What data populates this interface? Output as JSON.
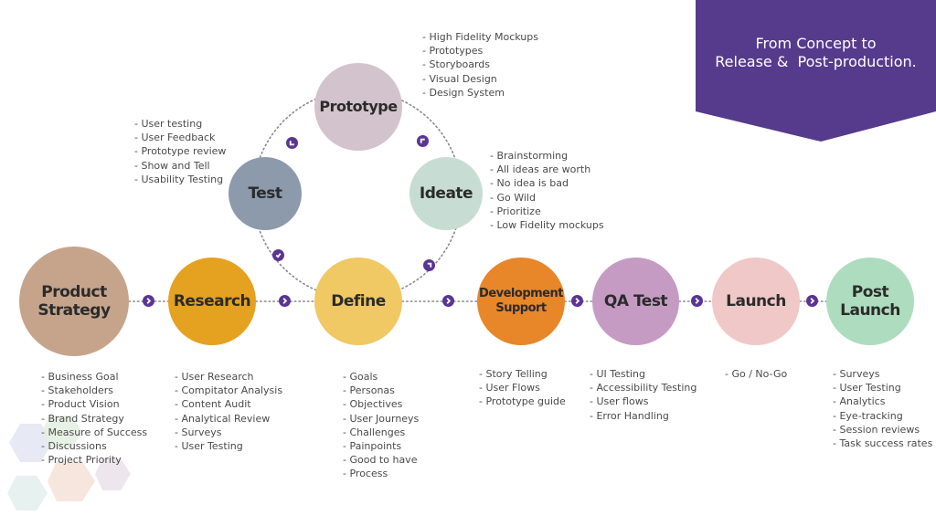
{
  "banner": {
    "line1": "From Concept to",
    "line2": "Release &  Post-production.",
    "color": "#563a8c"
  },
  "accent_color": "#5a3593",
  "main_flow": [
    {
      "id": "product-strategy",
      "label": "Product\nStrategy",
      "color": "#c6a48c",
      "items": [
        "Business Goal",
        "Stakeholders",
        "Product Vision",
        "Brand Strategy",
        "Measure of Success",
        "Discussions",
        "Project Priority"
      ]
    },
    {
      "id": "research",
      "label": "Research",
      "color": "#e5a120",
      "items": [
        "User Research",
        "Compitator Analysis",
        "Content Audit",
        "Analytical Review",
        "Surveys",
        "User Testing"
      ]
    },
    {
      "id": "define",
      "label": "Define",
      "color": "#f0c864",
      "items": [
        "Goals",
        "Personas",
        "Objectives",
        "User Journeys",
        "Challenges",
        "Painpoints",
        "Good to have",
        "Process"
      ]
    },
    {
      "id": "development-support",
      "label": "Development\nSupport",
      "color": "#e8862a",
      "items": [
        "Story Telling",
        "User Flows",
        "Prototype guide"
      ]
    },
    {
      "id": "qa-test",
      "label": "QA Test",
      "color": "#c59bc3",
      "items": [
        "UI Testing",
        "Accessibility Testing",
        "User flows",
        "Error Handling"
      ]
    },
    {
      "id": "launch",
      "label": "Launch",
      "color": "#f0c8c8",
      "items": [
        "Go / No-Go"
      ]
    },
    {
      "id": "post-launch",
      "label": "Post\nLaunch",
      "color": "#aedcbe",
      "items": [
        "Surveys",
        "User Testing",
        "Analytics",
        "Eye-tracking",
        "Session reviews",
        "Task success rates"
      ]
    }
  ],
  "cycle": [
    {
      "id": "test",
      "label": "Test",
      "color": "#8c9aab",
      "items": [
        "User testing",
        "User Feedback",
        "Prototype review",
        "Show and Tell",
        "Usability Testing"
      ]
    },
    {
      "id": "prototype",
      "label": "Prototype",
      "color": "#d3c3cc",
      "items": [
        "High Fidelity Mockups",
        "Prototypes",
        "Storyboards",
        "Visual Design",
        "Design System"
      ]
    },
    {
      "id": "ideate",
      "label": "Ideate",
      "color": "#c7ddd3",
      "items": [
        "Brainstorming",
        "All ideas are worth",
        "No idea is bad",
        "Go Wild",
        "Prioritize",
        "Low Fidelity mockups"
      ]
    }
  ]
}
